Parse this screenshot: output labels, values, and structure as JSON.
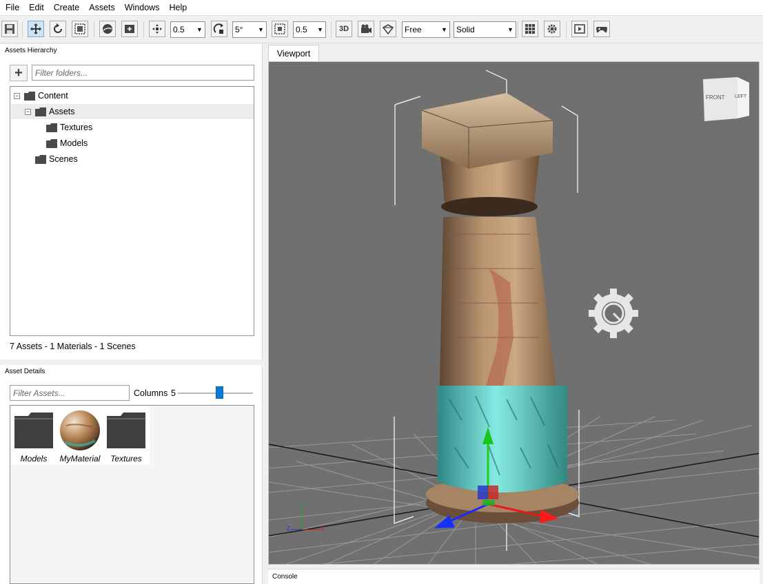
{
  "menu": [
    "File",
    "Edit",
    "Create",
    "Assets",
    "Windows",
    "Help"
  ],
  "toolbar": {
    "move_snap": "0.5",
    "rotate_snap": "5°",
    "scale_snap": "0.5",
    "view_3d_label": "3D",
    "camera_mode": "Free",
    "render_mode": "Solid"
  },
  "hierarchy": {
    "title": "Assets Hierarchy",
    "filter_placeholder": "Filter folders...",
    "tree": [
      {
        "label": "Content",
        "expanded": true
      },
      {
        "label": "Assets",
        "expanded": true,
        "selected": true
      },
      {
        "label": "Textures"
      },
      {
        "label": "Models"
      },
      {
        "label": "Scenes"
      }
    ],
    "status": "7 Assets - 1 Materials - 1 Scenes"
  },
  "details": {
    "title": "Asset Details",
    "filter_placeholder": "Filter Assets...",
    "columns_label": "Columns",
    "columns_value": "5",
    "columns_slider_fraction": 0.55,
    "assets": [
      {
        "name": "Models",
        "icon": "folder-icon"
      },
      {
        "name": "MyMaterial",
        "icon": "material-sphere-icon"
      },
      {
        "name": "Textures",
        "icon": "folder-icon"
      }
    ]
  },
  "viewport": {
    "tab": "Viewport",
    "cube_face_front": "FRONT",
    "cube_face_right": "LEFT",
    "axis_x": "X",
    "axis_y": "Y",
    "axis_z": "Z"
  },
  "console": {
    "title": "Console"
  },
  "colors": {
    "selection_blue": "#0a7ad6",
    "viewport_bg": "#707070",
    "glow": "#37d6d6"
  }
}
